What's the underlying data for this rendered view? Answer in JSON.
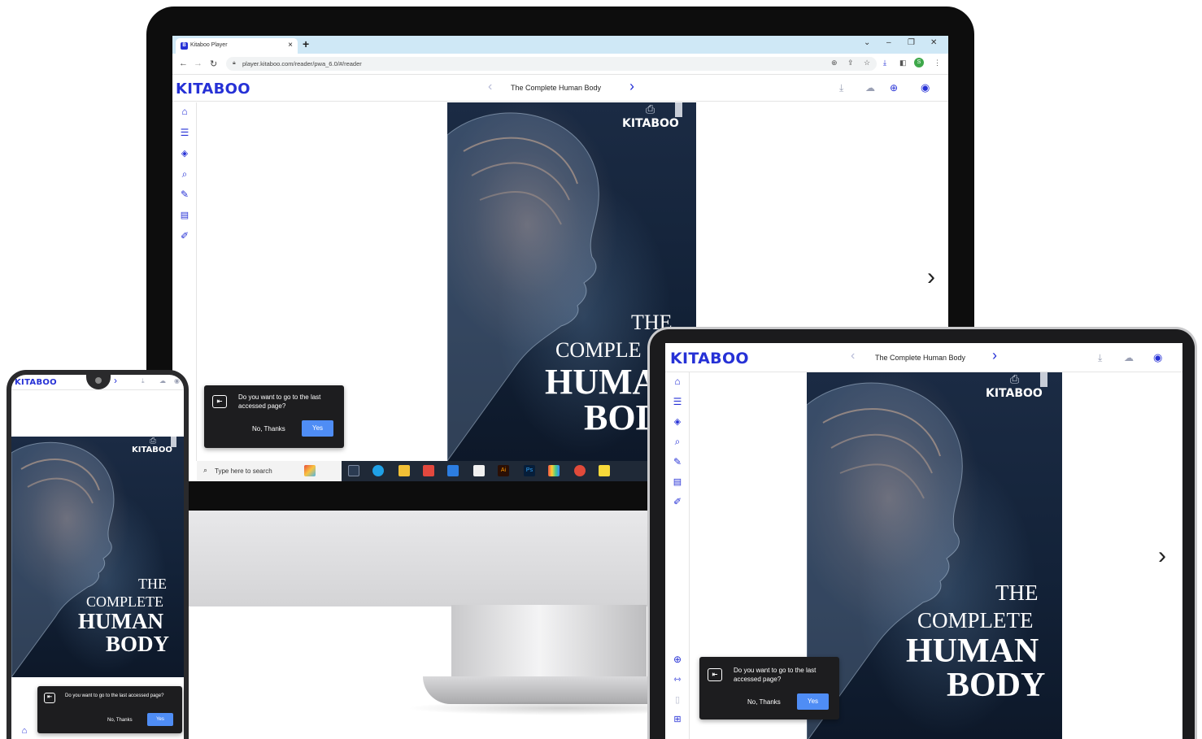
{
  "browser": {
    "tab_title": "Kitaboo Player",
    "tab_favicon": "B",
    "url": "player.kitaboo.com/reader/pwa_6.0/#/reader",
    "profile_initial": "S"
  },
  "reader": {
    "logo": "KITABOO",
    "book_title": "The Complete Human Body",
    "sidebar_icons": [
      "home-icon",
      "toc-icon",
      "resources-icon",
      "search-icon",
      "pen-icon",
      "notes-icon",
      "highlight-icon"
    ],
    "header_icons": [
      "download-icon",
      "cloud-icon",
      "globe-icon",
      "profile-icon"
    ]
  },
  "cover": {
    "publisher": "KITABOO",
    "line1": "THE",
    "line2": "COMPLETE",
    "line3": "HUMAN",
    "line4": "BODY",
    "desktop_line2": "COMPLE",
    "desktop_line3": "HUMA",
    "desktop_line4": "BOD"
  },
  "dialog": {
    "message": "Do you want to go to the last accessed page?",
    "no_label": "No, Thanks",
    "yes_label": "Yes"
  },
  "taskbar": {
    "search_placeholder": "Type here to search"
  },
  "colors": {
    "brand": "#2631d6",
    "dialog_bg": "#1d1d1f",
    "yes_button": "#4f8df5",
    "chrome_tabstrip": "#cfe8f6"
  }
}
